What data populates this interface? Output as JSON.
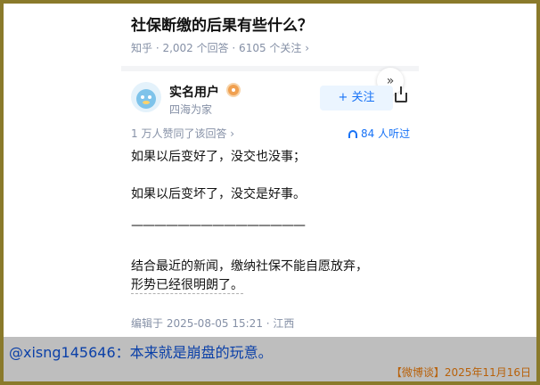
{
  "question": {
    "title": "社保断缴的后果有些什么？",
    "meta": "知乎 · 2,002 个回答 · 6105 个关注 ›"
  },
  "answer": {
    "collapse_icon": "double-chevron-down-icon",
    "author_name": "实名用户",
    "author_badge": "badge-icon",
    "author_bio": "四海为家",
    "follow_label": "+ 关注",
    "upvote_text": "1 万人赞同了该回答 ›",
    "listen_text": "84 人听过",
    "paragraphs": [
      "如果以后变好了，没交也没事；",
      "如果以后变坏了，没交是好事。",
      "———————————————",
      "结合最近的新闻，缴纳社保不能自愿放弃，",
      "形势已经很明朗了。"
    ],
    "edit_info": "编辑于 2025-08-05 15:21 · 江西"
  },
  "caption": {
    "text": "@xisng145646：本来就是崩盘的玩意。"
  },
  "footer": {
    "text": "【微博谈】2025年11月16日"
  },
  "colors": {
    "frame": "#8a7a2b",
    "caption_bg": "#bebebe",
    "caption_text": "#0b40a8",
    "footer_text": "#b8610a",
    "accent_blue": "#1772f6"
  }
}
